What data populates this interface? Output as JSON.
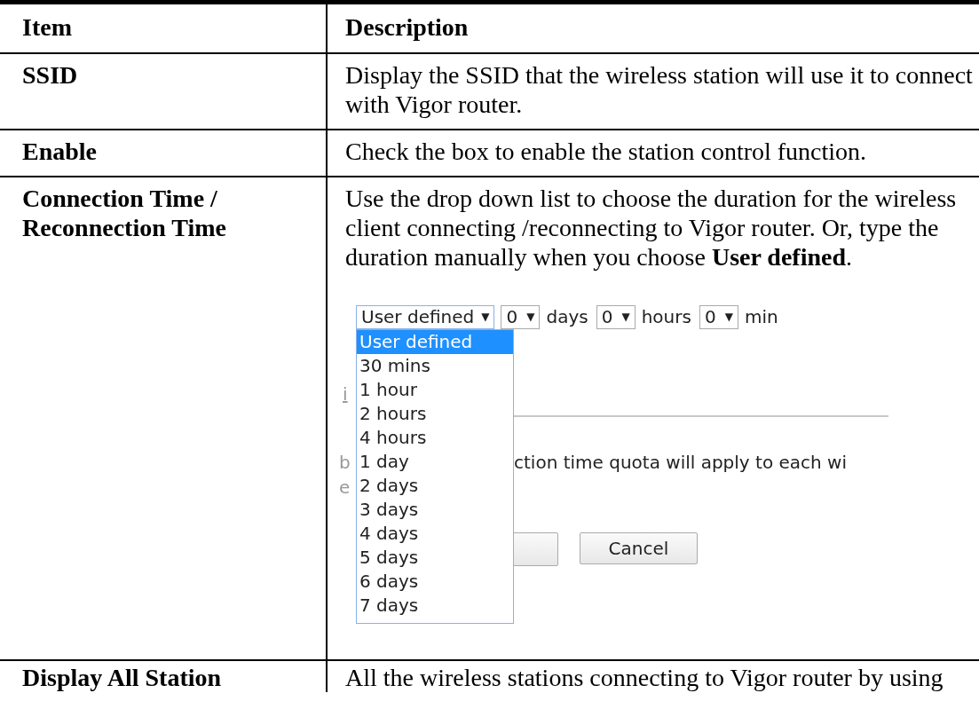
{
  "table": {
    "columns": [
      "Item",
      "Description"
    ],
    "rows": [
      {
        "item": "SSID",
        "description": "Display the SSID that the wireless station will use it to connect with Vigor router."
      },
      {
        "item": "Enable",
        "description": "Check the box to enable the station control function."
      },
      {
        "item": "Connection Time / Reconnection Time",
        "description": "Use the drop down list to choose the duration for the wireless client connecting /reconnecting to Vigor router. Or, type the duration manually when you choose **User defined**.",
        "screenshot": {
          "selects": [
            {
              "value": "User defined",
              "arrow": "▼"
            },
            {
              "value": "0",
              "arrow": "▼",
              "suffix": "days"
            },
            {
              "value": "0",
              "arrow": "▼",
              "suffix": "hours"
            },
            {
              "value": "0",
              "arrow": "▼",
              "suffix": "min"
            }
          ],
          "options": [
            {
              "label": "User defined",
              "selected": true
            },
            {
              "label": "30 mins",
              "selected": false
            },
            {
              "label": "1 hour",
              "selected": false
            },
            {
              "label": "2 hours",
              "selected": false
            },
            {
              "label": "4 hours",
              "selected": false
            },
            {
              "label": "1 day",
              "selected": false
            },
            {
              "label": "2 days",
              "selected": false
            },
            {
              "label": "3 days",
              "selected": false
            },
            {
              "label": "4 days",
              "selected": false
            },
            {
              "label": "5 days",
              "selected": false
            },
            {
              "label": "6 days",
              "selected": false
            },
            {
              "label": "7 days",
              "selected": false
            }
          ],
          "link_fragment": "i",
          "note_fragments": [
            "b",
            "e"
          ],
          "note_text": "ction time quota will apply to each wi",
          "cancel_button": "Cancel"
        }
      },
      {
        "item": "Display All Station",
        "description": "All the wireless stations connecting to Vigor router by using"
      }
    ]
  }
}
